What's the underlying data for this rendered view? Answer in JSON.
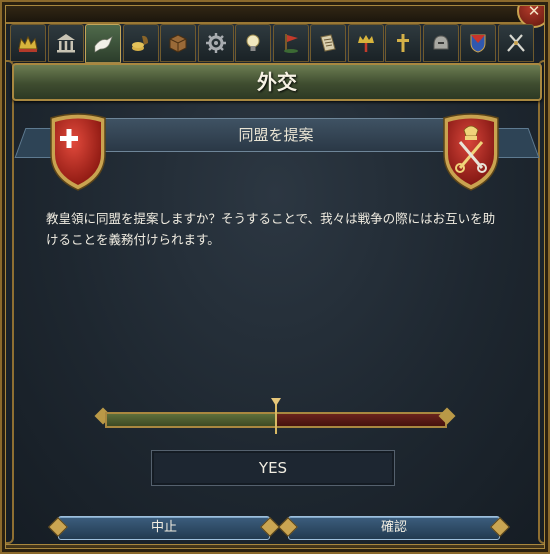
{
  "window": {
    "close_label": "✕"
  },
  "tabs": [
    {
      "name": "tab-court",
      "icon": "crown-icon"
    },
    {
      "name": "tab-government",
      "icon": "temple-icon"
    },
    {
      "name": "tab-diplomacy",
      "icon": "dove-icon",
      "active": true
    },
    {
      "name": "tab-economy",
      "icon": "coins-icon"
    },
    {
      "name": "tab-trade",
      "icon": "crate-icon"
    },
    {
      "name": "tab-production",
      "icon": "gear-icon"
    },
    {
      "name": "tab-ideas",
      "icon": "lightbulb-icon"
    },
    {
      "name": "tab-missions",
      "icon": "flag-icon"
    },
    {
      "name": "tab-decisions",
      "icon": "scroll-icon"
    },
    {
      "name": "tab-stability",
      "icon": "crown-sceptre-icon"
    },
    {
      "name": "tab-religion",
      "icon": "cross-icon"
    },
    {
      "name": "tab-military",
      "icon": "helmet-icon"
    },
    {
      "name": "tab-subjects",
      "icon": "shield-crest-icon"
    },
    {
      "name": "tab-estates",
      "icon": "swords-icon"
    }
  ],
  "title": "外交",
  "offer": {
    "title": "同盟を提案",
    "body": "教皇領に同盟を提案しますか？そうすることで、我々は戦争の際にはお互いを助けることを義務付けられます。",
    "left_shield_icon": "red-shield-white-cross-icon",
    "right_shield_icon": "papal-keys-shield-icon"
  },
  "acceptance": {
    "value": 0.5,
    "result": "YES",
    "colors": {
      "positive": "#5e6f3b",
      "negative": "#6b231d"
    }
  },
  "buttons": {
    "cancel": "中止",
    "confirm": "確認"
  }
}
